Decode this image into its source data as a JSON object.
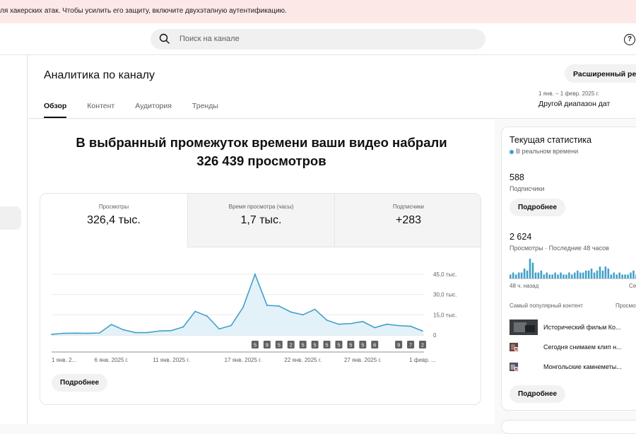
{
  "banner": {
    "text": "ля хакерских атак. Чтобы усилить его защиту, включите двухэтапную аутентификацию."
  },
  "search": {
    "placeholder": "Поиск на канале"
  },
  "header": {
    "title": "Аналитика по каналу",
    "advanced_button": "Расширенный режим",
    "tabs": [
      "Обзор",
      "Контент",
      "Аудитория",
      "Тренды"
    ],
    "date_range": "1 янв. – 1 февр. 2025 г.",
    "date_link": "Другой диапазон дат"
  },
  "main": {
    "headline_line1": "В выбранный промежуток времени ваши видео набрали",
    "headline_line2": "326 439 просмотров",
    "metrics": [
      {
        "label": "Просмотры",
        "value": "326,4 тыс."
      },
      {
        "label": "Время просмотра (часы)",
        "value": "1,7 тыс."
      },
      {
        "label": "Подписчики",
        "value": "+283"
      }
    ],
    "more_button": "Подробнее"
  },
  "chart_data": {
    "type": "area",
    "x": [
      "1 янв.",
      "2 янв.",
      "3 янв.",
      "4 янв.",
      "5 янв.",
      "6 янв.",
      "7 янв.",
      "8 янв.",
      "9 янв.",
      "10 янв.",
      "11 янв.",
      "12 янв.",
      "13 янв.",
      "14 янв.",
      "15 янв.",
      "16 янв.",
      "17 янв.",
      "18 янв.",
      "19 янв.",
      "20 янв.",
      "21 янв.",
      "22 янв.",
      "23 янв.",
      "24 янв.",
      "25 янв.",
      "26 янв.",
      "27 янв.",
      "28 янв.",
      "29 янв.",
      "30 янв.",
      "31 янв.",
      "1 февр."
    ],
    "values": [
      500,
      1300,
      1400,
      1300,
      1500,
      7800,
      3900,
      1800,
      1800,
      3000,
      3300,
      6000,
      17500,
      14000,
      4500,
      7000,
      20500,
      45000,
      22000,
      21500,
      17000,
      15000,
      19000,
      11000,
      8000,
      8500,
      10000,
      5500,
      8000,
      7000,
      6500,
      3000
    ],
    "ylim": [
      0,
      45000
    ],
    "y_ticks": [
      "45,0 тыс.",
      "30,0 тыс.",
      "15,0 тыс.",
      "0"
    ],
    "y_tick_values": [
      45000,
      30000,
      15000,
      0
    ],
    "x_tick_labels": [
      "1 янв. 2...",
      "6 янв. 2025 г.",
      "11 янв. 2025 г.",
      "17 янв. 2025 г.",
      "22 янв. 2025 г.",
      "27 янв. 2025 г.",
      "1 февр. ..."
    ],
    "x_tick_index": [
      0,
      5,
      10,
      16,
      21,
      26,
      31
    ],
    "grid": true,
    "markers": [
      {
        "index": 17,
        "label": "5"
      },
      {
        "index": 18,
        "label": "9"
      },
      {
        "index": 19,
        "label": "5"
      },
      {
        "index": 20,
        "label": "2"
      },
      {
        "index": 21,
        "label": "5"
      },
      {
        "index": 22,
        "label": "5"
      },
      {
        "index": 23,
        "label": "5"
      },
      {
        "index": 24,
        "label": "5"
      },
      {
        "index": 25,
        "label": "5"
      },
      {
        "index": 26,
        "label": "5"
      },
      {
        "index": 27,
        "label": "6"
      },
      {
        "index": 29,
        "label": "9"
      },
      {
        "index": 30,
        "label": "7"
      },
      {
        "index": 31,
        "label": "2"
      }
    ],
    "line_color": "#41a0c8",
    "fill_color": "#e3f1f8"
  },
  "side": {
    "title": "Текущая статистика",
    "live_label": "В реальном времени",
    "subscribers_value": "588",
    "subscribers_label": "Подписчики",
    "more_button_1": "Подробнее",
    "views_value": "2 624",
    "views_label": "Просмотры · Последние 48 часов",
    "mini_chart": {
      "type": "bar",
      "values": [
        2,
        3,
        2,
        3,
        3,
        5,
        4,
        10,
        8,
        3,
        3,
        4,
        2,
        3,
        2,
        2,
        3,
        2,
        3,
        2,
        2,
        3,
        2,
        3,
        4,
        3,
        3,
        4,
        4,
        5,
        3,
        4,
        6,
        4,
        6,
        5,
        2,
        3,
        2,
        3,
        2,
        2,
        2,
        3,
        4,
        2,
        3,
        4
      ],
      "color": "#41a0c8"
    },
    "mini_axis_left": "48 ч. назад",
    "mini_axis_right": "Сейчас",
    "popular_label": "Самый популярный контент",
    "popular_right_label": "Просмотры",
    "popular_items": [
      "Исторический фильм Ко...",
      "Сегодня снимаем клип н...",
      "Монгольские камнеметы..."
    ],
    "more_button_2": "Подробнее"
  }
}
